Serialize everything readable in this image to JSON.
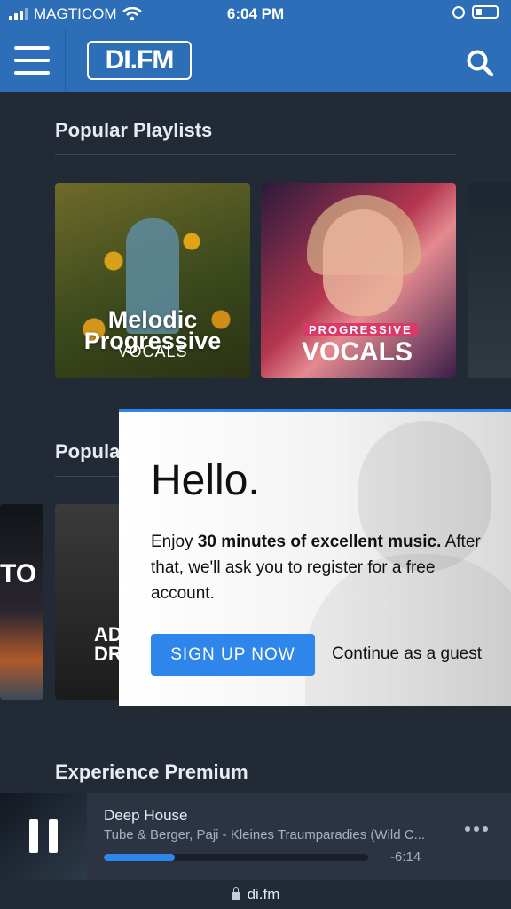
{
  "status_bar": {
    "carrier": "MAGTICOM",
    "time": "6:04 PM"
  },
  "header": {
    "logo_text": "DI.FM",
    "menu_icon": "hamburger-menu-icon",
    "search_icon": "search-icon",
    "bg_color": "#2c6fb8"
  },
  "sections": {
    "popular_playlists": "Popular Playlists",
    "popular_partial": "Popula",
    "experience_premium": "Experience Premium"
  },
  "playlists": [
    {
      "line1": "Melodic",
      "line2": "Progressive",
      "line3": "VOCALS"
    },
    {
      "tag": "PROGRESSIVE",
      "title": "VOCALS"
    }
  ],
  "channels_partial": {
    "card_a": "TO",
    "card_b_line1": "AD",
    "card_b_line2": "DR"
  },
  "modal": {
    "heading": "Hello.",
    "message_prefix": "Enjoy ",
    "message_bold": "30 minutes of excellent music.",
    "message_rest": " After that, we'll ask you to register for a free account.",
    "signup_label": "SIGN UP NOW",
    "guest_label": "Continue as a guest",
    "accent_color": "#2f86ea"
  },
  "player": {
    "channel": "Deep House",
    "track": "Tube & Berger, Paji - Kleines Traumparadies (Wild C...",
    "time_remaining": "-6:14",
    "progress": 0.27
  },
  "url_bar": {
    "url": "di.fm"
  }
}
